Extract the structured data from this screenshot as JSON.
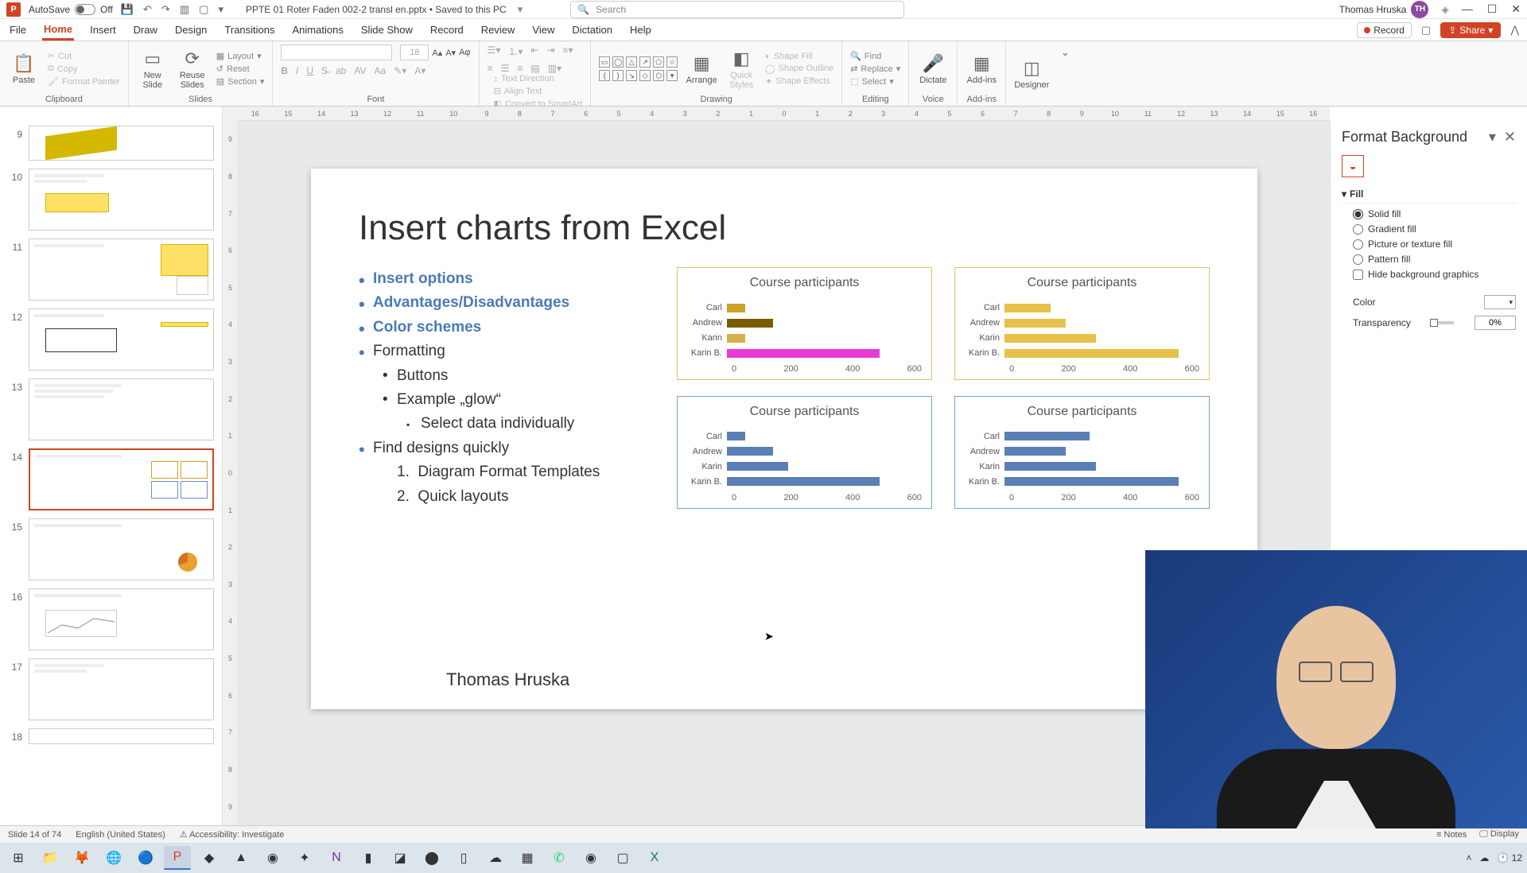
{
  "titlebar": {
    "autosave_label": "AutoSave",
    "autosave_state": "Off",
    "doc_title": "PPTE 01 Roter Faden 002-2 transl en.pptx • Saved to this PC",
    "search_placeholder": "Search",
    "user_name": "Thomas Hruska",
    "user_initials": "TH"
  },
  "tabs": {
    "items": [
      "File",
      "Home",
      "Insert",
      "Draw",
      "Design",
      "Transitions",
      "Animations",
      "Slide Show",
      "Record",
      "Review",
      "View",
      "Dictation",
      "Help"
    ],
    "active_index": 1,
    "record": "Record",
    "share": "Share"
  },
  "ribbon": {
    "clipboard": {
      "paste": "Paste",
      "cut": "Cut",
      "copy": "Copy",
      "format_painter": "Format Painter",
      "label": "Clipboard"
    },
    "slides": {
      "new_slide": "New\nSlide",
      "reuse": "Reuse\nSlides",
      "layout": "Layout",
      "reset": "Reset",
      "section": "Section",
      "label": "Slides"
    },
    "font": {
      "size": "18",
      "label": "Font"
    },
    "paragraph": {
      "text_direction": "Text Direction",
      "align_text": "Align Text",
      "convert": "Convert to SmartArt",
      "label": "Paragraph"
    },
    "drawing": {
      "arrange": "Arrange",
      "quick_styles": "Quick\nStyles",
      "shape_fill": "Shape Fill",
      "shape_outline": "Shape Outline",
      "shape_effects": "Shape Effects",
      "label": "Drawing"
    },
    "editing": {
      "find": "Find",
      "replace": "Replace",
      "select": "Select",
      "label": "Editing"
    },
    "voice": {
      "dictate": "Dictate",
      "label": "Voice"
    },
    "addins": {
      "addins": "Add-ins",
      "label": "Add-ins"
    },
    "designer": {
      "designer": "Designer"
    }
  },
  "thumbnails": {
    "start_num": 9,
    "items": [
      {
        "num": 9
      },
      {
        "num": 10
      },
      {
        "num": 11
      },
      {
        "num": 12
      },
      {
        "num": 13
      },
      {
        "num": 14,
        "active": true
      },
      {
        "num": 15
      },
      {
        "num": 16
      },
      {
        "num": 17
      },
      {
        "num": 18
      }
    ]
  },
  "slide": {
    "title": "Insert charts from Excel",
    "bullets": {
      "insert_options": "Insert options",
      "adv_dis": "Advantages/Disadvantages",
      "color": "Color schemes",
      "formatting": "Formatting",
      "buttons": "Buttons",
      "glow": "Example „glow“",
      "select_data": "Select data individually",
      "find": "Find designs quickly",
      "diagram": "Diagram Format Templates",
      "quick": "Quick layouts",
      "num1": "1.",
      "num2": "2."
    },
    "author": "Thomas Hruska"
  },
  "chart_data": [
    {
      "type": "bar",
      "title": "Course participants",
      "orientation": "horizontal",
      "categories": [
        "Carl",
        "Andrew",
        "Karin",
        "Karin B."
      ],
      "values": [
        60,
        150,
        60,
        500
      ],
      "colors": [
        "#c9a227",
        "#7a5c00",
        "#d4b24a",
        "#e83ad6"
      ],
      "xlim": [
        0,
        600
      ],
      "xticks": [
        0,
        200,
        400,
        600
      ]
    },
    {
      "type": "bar",
      "title": "Course participants",
      "orientation": "horizontal",
      "categories": [
        "Carl",
        "Andrew",
        "Karin",
        "Karin B."
      ],
      "values": [
        150,
        200,
        300,
        570
      ],
      "colors": [
        "#e6c24a",
        "#e6c24a",
        "#e6c24a",
        "#e6c24a"
      ],
      "xlim": [
        0,
        600
      ],
      "xticks": [
        0,
        200,
        400,
        600
      ]
    },
    {
      "type": "bar",
      "title": "Course participants",
      "orientation": "horizontal",
      "categories": [
        "Carl",
        "Andrew",
        "Karin",
        "Karin B."
      ],
      "values": [
        60,
        150,
        200,
        500
      ],
      "colors": [
        "#5a7fb5",
        "#5a7fb5",
        "#5a7fb5",
        "#5a7fb5"
      ],
      "xlim": [
        0,
        600
      ],
      "xticks": [
        0,
        200,
        400,
        600
      ]
    },
    {
      "type": "bar",
      "title": "Course participants",
      "orientation": "horizontal",
      "categories": [
        "Carl",
        "Andrew",
        "Karin",
        "Karin B."
      ],
      "values": [
        280,
        200,
        300,
        570
      ],
      "colors": [
        "#5a7fb5",
        "#5a7fb5",
        "#5a7fb5",
        "#5a7fb5"
      ],
      "xlim": [
        0,
        600
      ],
      "xticks": [
        0,
        200,
        400,
        600
      ]
    }
  ],
  "format_pane": {
    "title": "Format Background",
    "fill_section": "Fill",
    "solid": "Solid fill",
    "gradient": "Gradient fill",
    "picture": "Picture or texture fill",
    "pattern": "Pattern fill",
    "hide_bg": "Hide background graphics",
    "color_label": "Color",
    "transparency_label": "Transparency",
    "transparency_value": "0%"
  },
  "statusbar": {
    "slide_info": "Slide 14 of 74",
    "language": "English (United States)",
    "accessibility": "Accessibility: Investigate",
    "notes": "Notes",
    "display": "Display"
  },
  "taskbar": {
    "time": "12"
  },
  "ruler": {
    "h": [
      "16",
      "15",
      "14",
      "13",
      "12",
      "11",
      "10",
      "9",
      "8",
      "7",
      "6",
      "5",
      "4",
      "3",
      "2",
      "1",
      "0",
      "1",
      "2",
      "3",
      "4",
      "5",
      "6",
      "7",
      "8",
      "9",
      "10",
      "11",
      "12",
      "13",
      "14",
      "15",
      "16"
    ]
  }
}
